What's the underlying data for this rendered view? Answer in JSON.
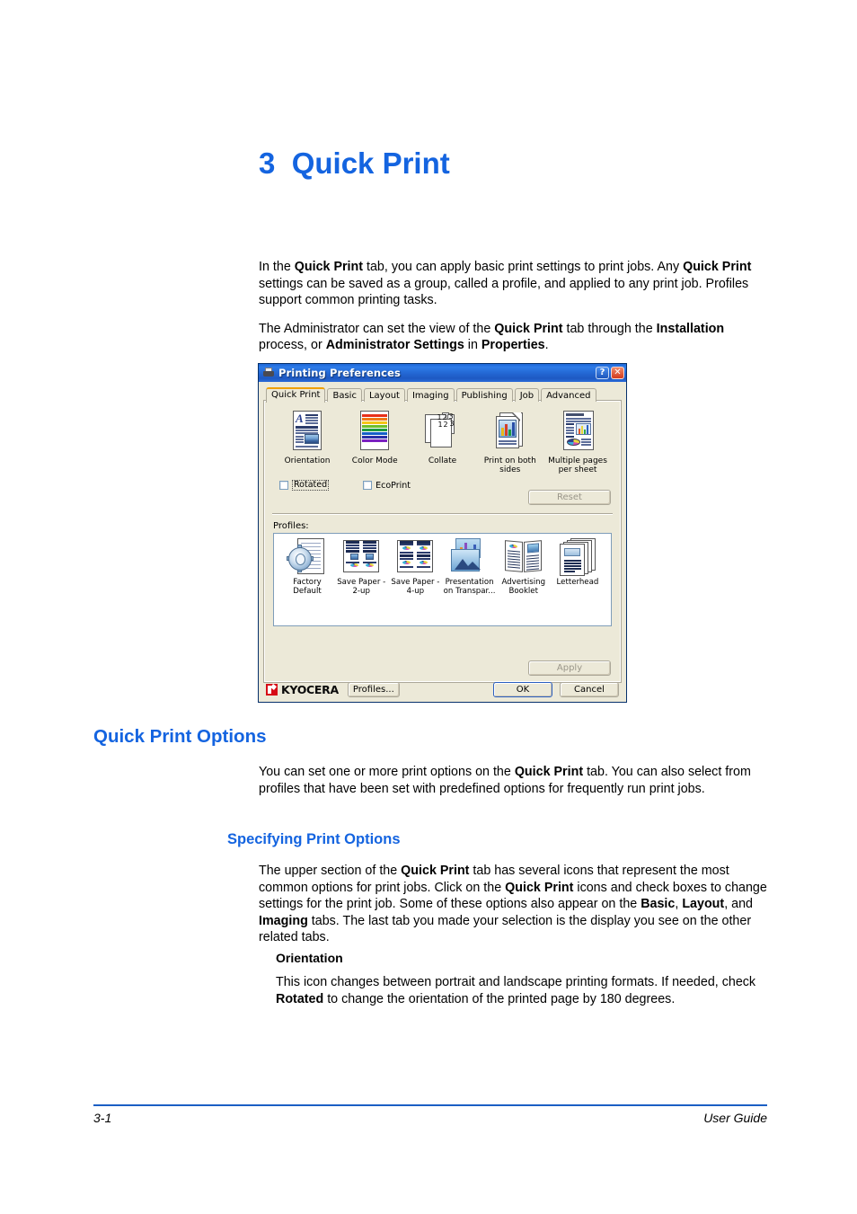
{
  "chapter": {
    "number": "3",
    "title": "Quick Print"
  },
  "intro": {
    "p1_a": "In the ",
    "p1_b1": "Quick Print",
    "p1_b": " tab, you can apply basic print settings to print jobs. Any ",
    "p1_b2": "Quick Print",
    "p1_c": " settings can be saved as a group, called a profile, and applied to any print job. Profiles support common printing tasks.",
    "p2_a": "The Administrator can set the view of the ",
    "p2_b1": "Quick Print",
    "p2_b": " tab through the ",
    "p2_b2": "Installation",
    "p2_c": " process, or ",
    "p2_b3": "Administrator Settings",
    "p2_d": " in ",
    "p2_b4": "Properties",
    "p2_e": "."
  },
  "dialog": {
    "title": "Printing Preferences",
    "title_icon": "printer-icon",
    "help_button": "?",
    "close_button": "✕",
    "tabs": [
      {
        "label": "Quick Print",
        "active": true
      },
      {
        "label": "Basic",
        "active": false
      },
      {
        "label": "Layout",
        "active": false
      },
      {
        "label": "Imaging",
        "active": false
      },
      {
        "label": "Publishing",
        "active": false
      },
      {
        "label": "Job",
        "active": false
      },
      {
        "label": "Advanced",
        "active": false
      }
    ],
    "print_options": [
      {
        "label": "Orientation",
        "icon": "orientation-icon"
      },
      {
        "label": "Color Mode",
        "icon": "color-mode-icon"
      },
      {
        "label": "Collate",
        "icon": "collate-icon"
      },
      {
        "label": "Print on both sides",
        "icon": "duplex-icon"
      },
      {
        "label": "Multiple pages per sheet",
        "icon": "multiple-pages-icon"
      }
    ],
    "checkboxes": [
      {
        "label": "Rotated",
        "checked": false,
        "focused": true
      },
      {
        "label": "EcoPrint",
        "checked": false,
        "focused": false
      }
    ],
    "reset_button": "Reset",
    "profiles_group_label": "Profiles:",
    "profiles": [
      {
        "label": "Factory Default",
        "icon": "factory-default-icon"
      },
      {
        "label": "Save Paper - 2-up",
        "icon": "save-paper-2up-icon"
      },
      {
        "label": "Save Paper - 4-up",
        "icon": "save-paper-4up-icon"
      },
      {
        "label": "Presentation on Transpar...",
        "icon": "presentation-transparency-icon"
      },
      {
        "label": "Advertising Booklet",
        "icon": "advertising-booklet-icon"
      },
      {
        "label": "Letterhead",
        "icon": "letterhead-icon"
      }
    ],
    "apply_button": "Apply",
    "brand": "KYOCERA",
    "profiles_button": "Profiles...",
    "ok_button": "OK",
    "cancel_button": "Cancel",
    "colors": {
      "title_bar": "#2468d4",
      "face": "#ece9d8",
      "tab_accent": "#f0a000",
      "brand_red": "#d60b16"
    }
  },
  "section1": {
    "heading": "Quick Print Options",
    "body_a": "You can set one or more print options on the ",
    "body_b1": "Quick Print",
    "body_c": " tab. You can also select from profiles that have been set with predefined options for frequently run print jobs."
  },
  "section2": {
    "heading": "Specifying Print Options",
    "body_a": "The upper section of the ",
    "body_b1": "Quick Print",
    "body_b": " tab has several icons that represent the most common options for print jobs. Click on the ",
    "body_b2": "Quick Print",
    "body_c": " icons and check boxes to change settings for the print job. Some of these options also appear on the ",
    "body_b3": "Basic",
    "body_d": ", ",
    "body_b4": "Layout",
    "body_e": ", and ",
    "body_b5": "Imaging",
    "body_f": " tabs. The last tab you made your selection is the display you see on the other related tabs."
  },
  "subsection": {
    "heading": "Orientation",
    "body_a": "This icon changes between portrait and landscape printing formats. If needed, check ",
    "body_b1": "Rotated",
    "body_b": " to change the orientation of the printed page by 180 degrees."
  },
  "footer": {
    "page_number": "3-1",
    "doc_name": "User Guide",
    "rule_color": "#1b5fc4"
  },
  "theme": {
    "heading_blue": "#1464e0"
  }
}
